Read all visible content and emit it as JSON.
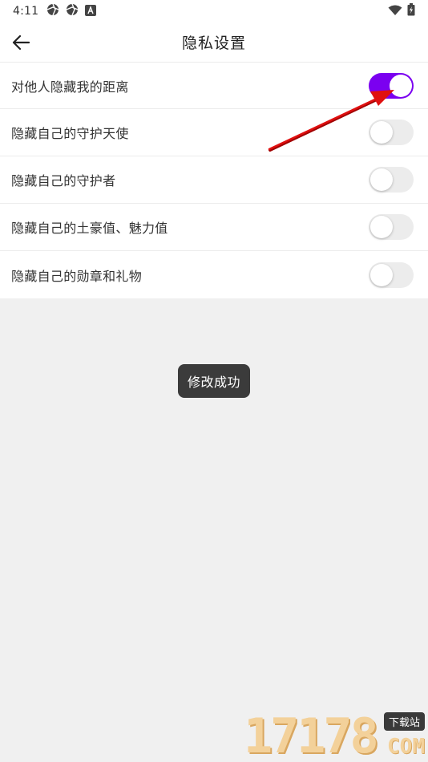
{
  "status_bar": {
    "time": "4:11"
  },
  "header": {
    "title": "隐私设置"
  },
  "settings": [
    {
      "label": "对他人隐藏我的距离",
      "enabled": true
    },
    {
      "label": "隐藏自己的守护天使",
      "enabled": false
    },
    {
      "label": "隐藏自己的守护者",
      "enabled": false
    },
    {
      "label": "隐藏自己的土豪值、魅力值",
      "enabled": false
    },
    {
      "label": "隐藏自己的勋章和礼物",
      "enabled": false
    }
  ],
  "toast": {
    "message": "修改成功"
  },
  "watermark": {
    "digits": "17178",
    "badge": "下载站",
    "suffix": "COM"
  },
  "colors": {
    "toggle_on": "#7b00f0",
    "toggle_off": "#ececec",
    "annotation_arrow": "#e01010"
  }
}
